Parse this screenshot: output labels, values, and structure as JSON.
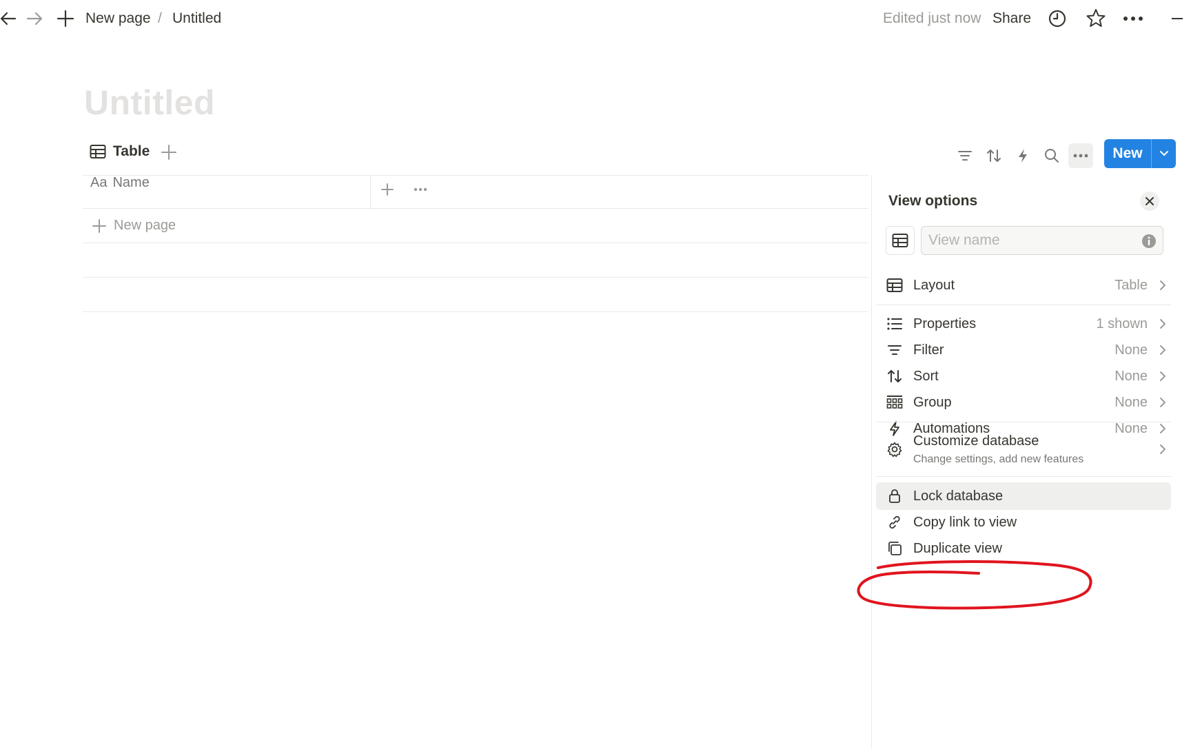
{
  "topbar": {
    "breadcrumb_parent": "New page",
    "breadcrumb_sep": "/",
    "breadcrumb_current": "Untitled",
    "edited_status": "Edited just now",
    "share_label": "Share"
  },
  "page": {
    "title": "Untitled"
  },
  "view_tabs": {
    "active_label": "Table"
  },
  "toolbar": {
    "new_label": "New"
  },
  "table": {
    "column_type_label": "Aa",
    "column_name": "Name",
    "new_row_label": "New page"
  },
  "panel": {
    "title": "View options",
    "view_name_placeholder": "View name",
    "view_name_value": "",
    "layout": {
      "label": "Layout",
      "value": "Table"
    },
    "settings": [
      {
        "label": "Properties",
        "value": "1 shown",
        "icon": "list-icon"
      },
      {
        "label": "Filter",
        "value": "None",
        "icon": "filter-icon"
      },
      {
        "label": "Sort",
        "value": "None",
        "icon": "sort-icon"
      },
      {
        "label": "Group",
        "value": "None",
        "icon": "group-grid-icon"
      },
      {
        "label": "Automations",
        "value": "None",
        "icon": "lightning-icon"
      }
    ],
    "customize": {
      "label": "Customize database",
      "sublabel": "Change settings, add new features"
    },
    "actions": [
      {
        "label": "Lock database",
        "icon": "lock-icon"
      },
      {
        "label": "Copy link to view",
        "icon": "link-icon"
      },
      {
        "label": "Duplicate view",
        "icon": "duplicate-icon"
      }
    ]
  },
  "colors": {
    "accent": "#2383e2",
    "text": "#37352f",
    "muted": "#9b9a97",
    "hover_bg": "#efefee",
    "annotation": "#e0141e"
  }
}
